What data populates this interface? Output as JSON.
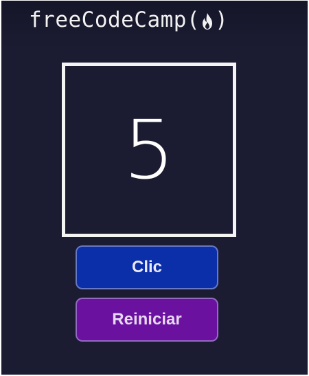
{
  "header": {
    "logo_text": "freeCodeCamp",
    "open_paren": "(",
    "close_paren": ")",
    "logo_icon": "flame-icon"
  },
  "counter": {
    "value": "5"
  },
  "buttons": {
    "click_label": "Clic",
    "reset_label": "Reiniciar"
  },
  "colors": {
    "background": "#1b1b32",
    "click_button": "#0b2fa8",
    "reset_button": "#6a11a0",
    "box_border": "#f4f4f4"
  }
}
